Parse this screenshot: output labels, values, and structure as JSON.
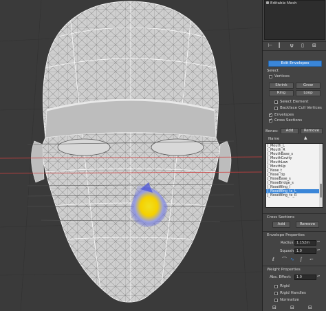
{
  "modifier_stack": {
    "item": "Editable Mesh"
  },
  "toolbar_icons": [
    "pin-icon",
    "bar-icon",
    "fork-icon",
    "delete-icon",
    "configure-icon"
  ],
  "envelope": {
    "button": "Edit Envelopes",
    "select_title": "Select",
    "vertices": "Vertices",
    "shrink": "Shrink",
    "grow": "Grow",
    "ring": "Ring",
    "loop": "Loop",
    "select_element": "Select Element",
    "backface": "Backface Cull Vertices",
    "envelopes": "Envelopes",
    "cross_sections": "Cross Sections"
  },
  "bones": {
    "label": "Bones:",
    "add": "Add",
    "remove": "Remove",
    "name_header": "Name",
    "items": [
      "J_Mouth_L",
      "J_Mouth_R",
      "J_MouthBase_s",
      "J_MouthCavity",
      "J_MouthLow",
      "J_MouthUp",
      "J_Nose_t",
      "J_Nose_tip",
      "J_NoseBase_s",
      "J_NoseBridge_s",
      "J_NoseWing_l",
      "J_NoseWing_tx_L",
      "J_NoseWing_tx_R"
    ],
    "selected_index": 11
  },
  "cross_sections": {
    "title": "Cross Sections",
    "add": "Add",
    "remove": "Remove"
  },
  "envelope_props": {
    "title": "Envelope Properties",
    "radius_label": "Radius:",
    "radius_value": "1.152m",
    "squash_label": "Squash:",
    "squash_value": "1.0"
  },
  "weight_props": {
    "title": "Weight Properties",
    "abs_effect_label": "Abs. Effect:",
    "abs_effect_value": "1.0",
    "rigid": "Rigid",
    "rigid_handles": "Rigid Handles",
    "normalize": "Normalize"
  },
  "colors": {
    "accent": "#3a86d8",
    "panel": "#444444",
    "viewport": "#3a3a3a"
  }
}
